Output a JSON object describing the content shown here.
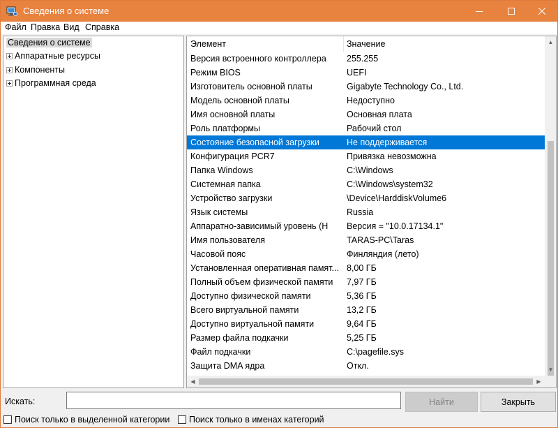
{
  "window": {
    "title": "Сведения о системе",
    "accent_color": "#e8823f",
    "min_icon": "minimize-icon",
    "max_icon": "maximize-icon",
    "close_icon": "close-icon"
  },
  "menu": [
    "Файл",
    "Правка",
    "Вид",
    "Справка"
  ],
  "tree": {
    "root": "Сведения о системе",
    "children": [
      "Аппаратные ресурсы",
      "Компоненты",
      "Программная среда"
    ]
  },
  "list": {
    "columns": [
      "Элемент",
      "Значение"
    ],
    "selected_color": "#0078d7",
    "rows": [
      {
        "item": "Версия встроенного контроллера",
        "value": "255.255"
      },
      {
        "item": "Режим BIOS",
        "value": "UEFI"
      },
      {
        "item": "Изготовитель основной платы",
        "value": "Gigabyte Technology Co., Ltd."
      },
      {
        "item": "Модель основной платы",
        "value": "Недоступно"
      },
      {
        "item": "Имя основной платы",
        "value": "Основная плата"
      },
      {
        "item": "Роль платформы",
        "value": "Рабочий стол"
      },
      {
        "item": "Состояние безопасной загрузки",
        "value": "Не поддерживается",
        "selected": true
      },
      {
        "item": "Конфигурация PCR7",
        "value": "Привязка невозможна"
      },
      {
        "item": "Папка Windows",
        "value": "C:\\Windows"
      },
      {
        "item": "Системная папка",
        "value": "C:\\Windows\\system32"
      },
      {
        "item": "Устройство загрузки",
        "value": "\\Device\\HarddiskVolume6"
      },
      {
        "item": "Язык системы",
        "value": "Russia"
      },
      {
        "item": "Аппаратно-зависимый уровень (Н",
        "value": "Версия = \"10.0.17134.1\""
      },
      {
        "item": "Имя пользователя",
        "value": "TARAS-PC\\Taras"
      },
      {
        "item": "Часовой пояс",
        "value": "Финляндия (лето)"
      },
      {
        "item": "Установленная оперативная памят...",
        "value": "8,00 ГБ"
      },
      {
        "item": "Полный объем физической памяти",
        "value": "7,97 ГБ"
      },
      {
        "item": "Доступно физической памяти",
        "value": "5,36 ГБ"
      },
      {
        "item": "Всего виртуальной памяти",
        "value": "13,2 ГБ"
      },
      {
        "item": "Доступно виртуальной памяти",
        "value": "9,64 ГБ"
      },
      {
        "item": "Размер файла подкачки",
        "value": "5,25 ГБ"
      },
      {
        "item": "Файл подкачки",
        "value": "C:\\pagefile.sys"
      },
      {
        "item": "Защита DMA ядра",
        "value": "Откл."
      }
    ]
  },
  "search": {
    "label": "Искать:",
    "value": "",
    "find_button": "Найти",
    "close_button": "Закрыть",
    "option1": "Поиск только в выделенной категории",
    "option2": "Поиск только в именах категорий"
  }
}
